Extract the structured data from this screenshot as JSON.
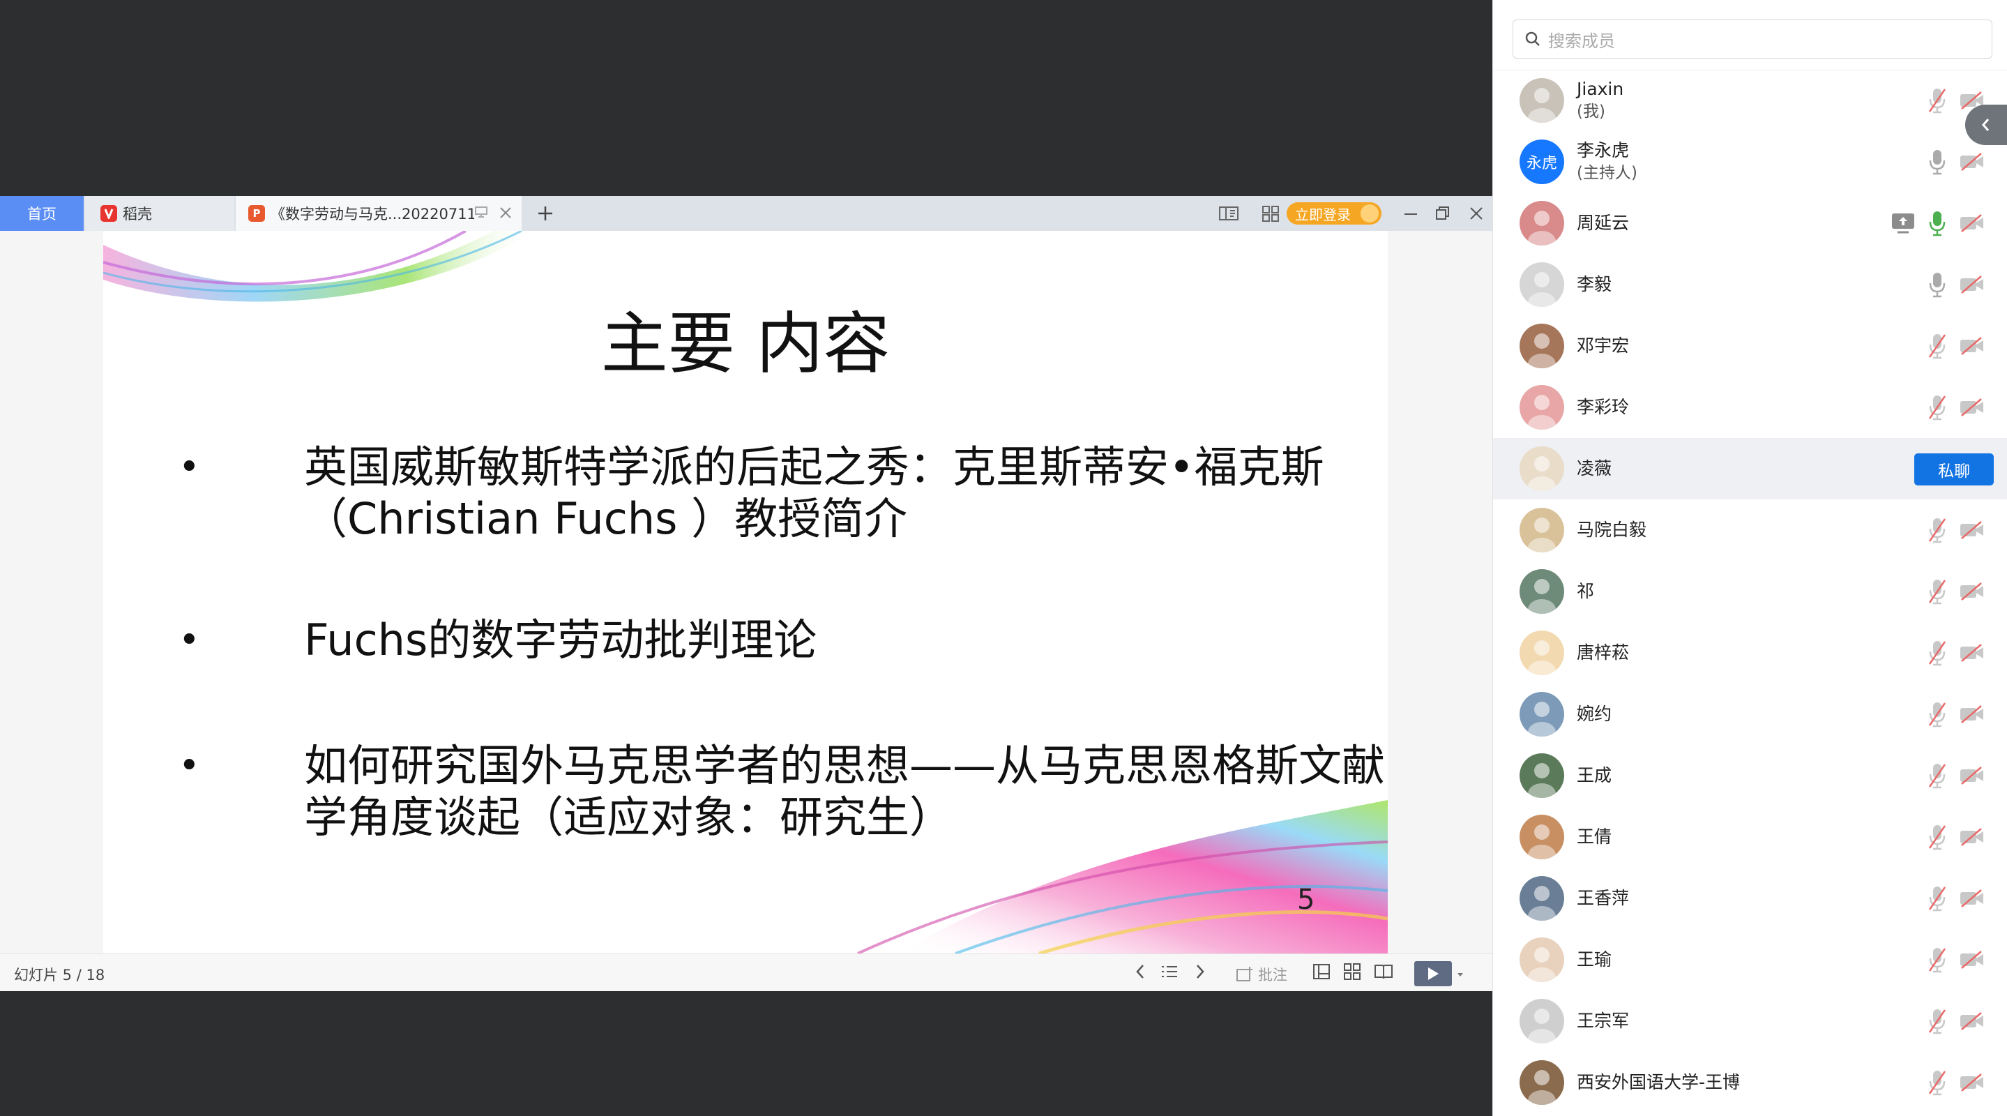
{
  "wps": {
    "tabs": [
      {
        "label": "首页",
        "icon": "home"
      },
      {
        "label": "稻壳",
        "icon": "daoke-logo-icon"
      },
      {
        "label": "《数字劳动与马克...20220711",
        "icon": "ppt-file-icon"
      }
    ],
    "login_label": "立即登录",
    "status": {
      "slide_counter": "幻灯片 5 / 18",
      "annotate_label": "批注"
    },
    "colors": {
      "home_tab": "#5b8ef5",
      "login": "#f5a623",
      "play": "#5f6b82"
    }
  },
  "slide": {
    "title": "主要  内容",
    "bullets": [
      {
        "prefix": "英国威斯敏斯特学派的后起之秀：",
        "name": "克里斯蒂安•福克斯",
        "line2": "（Christian Fuchs ）教授简介"
      },
      {
        "text": "Fuchs的数字劳动批判理论"
      },
      {
        "line1": "如何研究国外马克思学者的思想——从马克思恩格斯文献",
        "line2": "学角度谈起（适应对象：研究生）"
      }
    ],
    "page_number": "5"
  },
  "panel": {
    "search_placeholder": "搜索成员",
    "chat_button": "私聊",
    "members": [
      {
        "name": "Jiaxin",
        "role": "(我)",
        "mic": "muted",
        "cam": "off",
        "avatar_color": "#c9c2b8"
      },
      {
        "name": "李永虎",
        "role": "(主持人)",
        "avatar_text": "永虎",
        "mic": "on",
        "cam": "off",
        "avatar_color": "#1677ff"
      },
      {
        "name": "周延云",
        "mic": "active",
        "cam": "off",
        "sharing": true,
        "avatar_color": "#d98a8a"
      },
      {
        "name": "李毅",
        "mic": "on",
        "cam": "off",
        "avatar_color": "#d6d6d6"
      },
      {
        "name": "邓宇宏",
        "mic": "muted",
        "cam": "off",
        "avatar_color": "#a6765a"
      },
      {
        "name": "李彩玲",
        "mic": "muted",
        "cam": "off",
        "avatar_color": "#e8a6a6"
      },
      {
        "name": "凌薇",
        "mic": "hidden",
        "cam": "hidden",
        "highlight": true,
        "avatar_color": "#e9dcc9"
      },
      {
        "name": "马院白毅",
        "mic": "muted",
        "cam": "off",
        "avatar_color": "#d9c29a"
      },
      {
        "name": "祁",
        "mic": "muted",
        "cam": "off",
        "avatar_color": "#6e8a78"
      },
      {
        "name": "唐梓菘",
        "mic": "muted",
        "cam": "off",
        "avatar_color": "#f2d9b0"
      },
      {
        "name": "婉约",
        "mic": "muted",
        "cam": "off",
        "avatar_color": "#7d9bb8"
      },
      {
        "name": "王成",
        "mic": "muted",
        "cam": "off",
        "avatar_color": "#5b7a5a"
      },
      {
        "name": "王倩",
        "mic": "muted",
        "cam": "off",
        "avatar_color": "#c78f62"
      },
      {
        "name": "王香萍",
        "mic": "muted",
        "cam": "off",
        "avatar_color": "#6a7f96"
      },
      {
        "name": "王瑜",
        "mic": "muted",
        "cam": "off",
        "avatar_color": "#e8d2bd"
      },
      {
        "name": "王宗军",
        "mic": "muted",
        "cam": "off",
        "avatar_color": "#cfcfcf"
      },
      {
        "name": "西安外国语大学-王博",
        "mic": "muted",
        "cam": "off",
        "avatar_color": "#8a6b4d"
      }
    ]
  }
}
